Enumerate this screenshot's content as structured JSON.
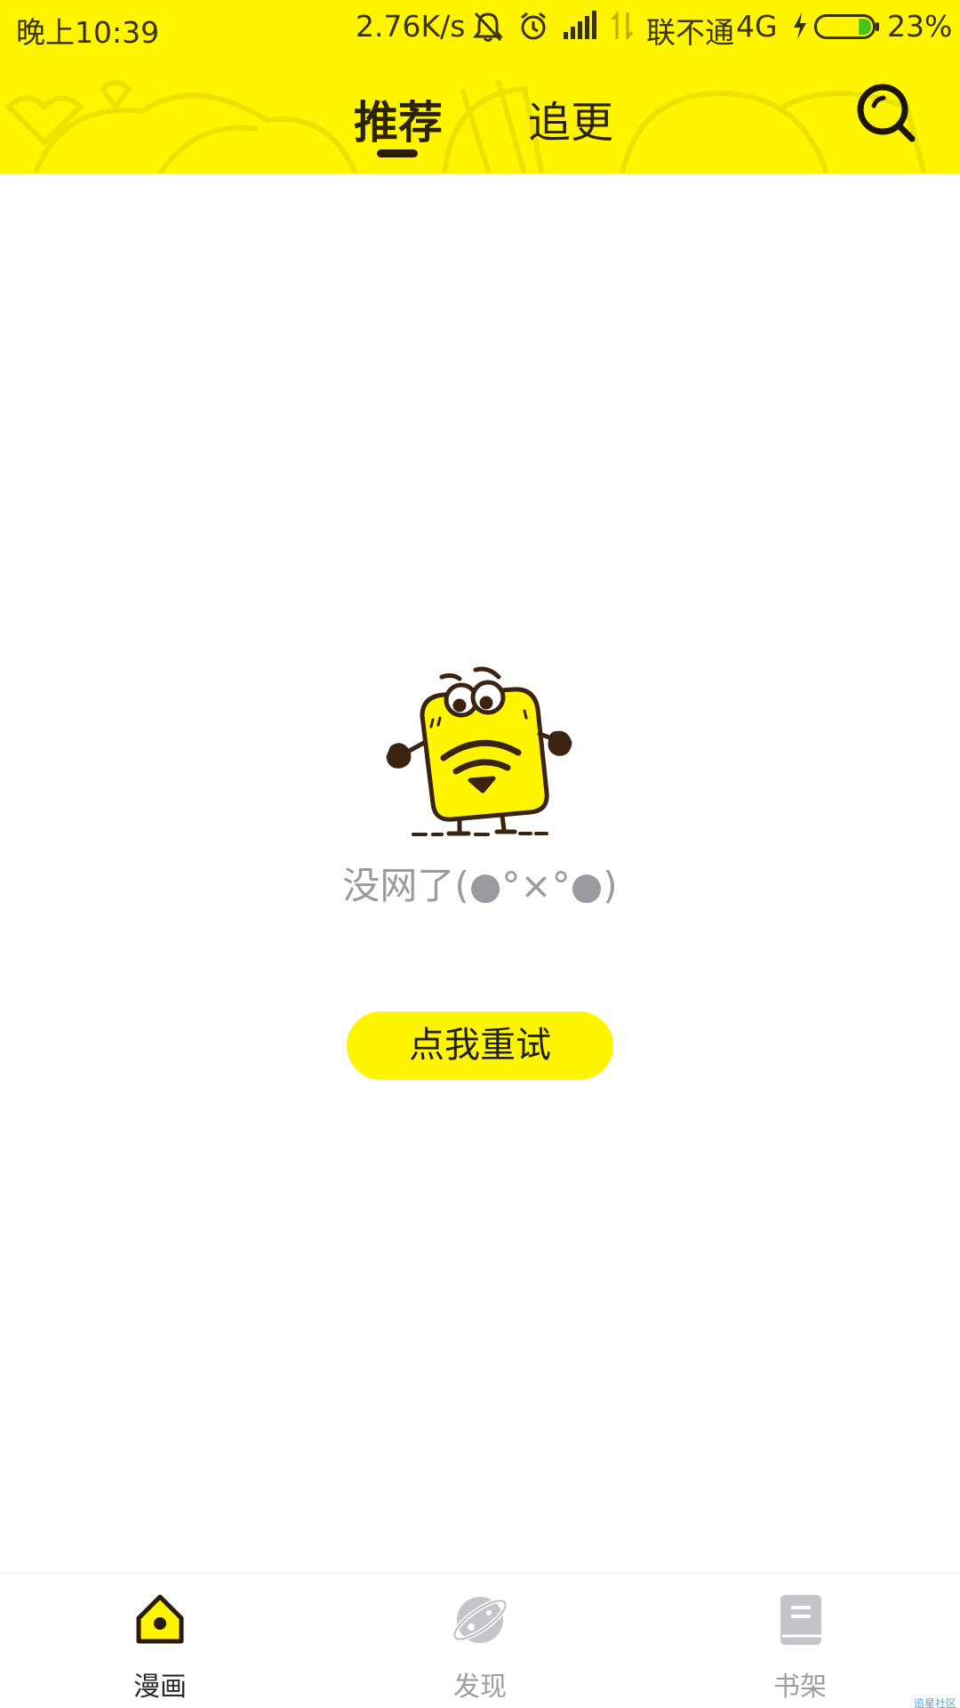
{
  "colors": {
    "brand_yellow": "#fff500",
    "dark_brown": "#3a2411",
    "muted_gray": "#9a9ba1"
  },
  "status_bar": {
    "time": "晚上10:39",
    "net_speed": "2.76K/s",
    "carrier": "联不通",
    "network_type": "4G",
    "battery_percent": "23%",
    "battery_level": 0.23,
    "icons": [
      "bell-off-icon",
      "alarm-icon",
      "signal-icon",
      "data-arrows-icon",
      "charging-icon",
      "battery-icon"
    ]
  },
  "header": {
    "tabs": [
      {
        "label": "推荐",
        "active": true
      },
      {
        "label": "追更",
        "active": false
      }
    ],
    "search_icon": "search-icon"
  },
  "empty_state": {
    "illustration": "no-wifi-mascot",
    "message": "没网了(●°×°●)",
    "retry_label": "点我重试"
  },
  "bottom_nav": {
    "items": [
      {
        "label": "漫画",
        "icon": "home-icon",
        "active": true
      },
      {
        "label": "发现",
        "icon": "planet-icon",
        "active": false
      },
      {
        "label": "书架",
        "icon": "book-icon",
        "active": false
      }
    ]
  },
  "watermark": "追星社区"
}
